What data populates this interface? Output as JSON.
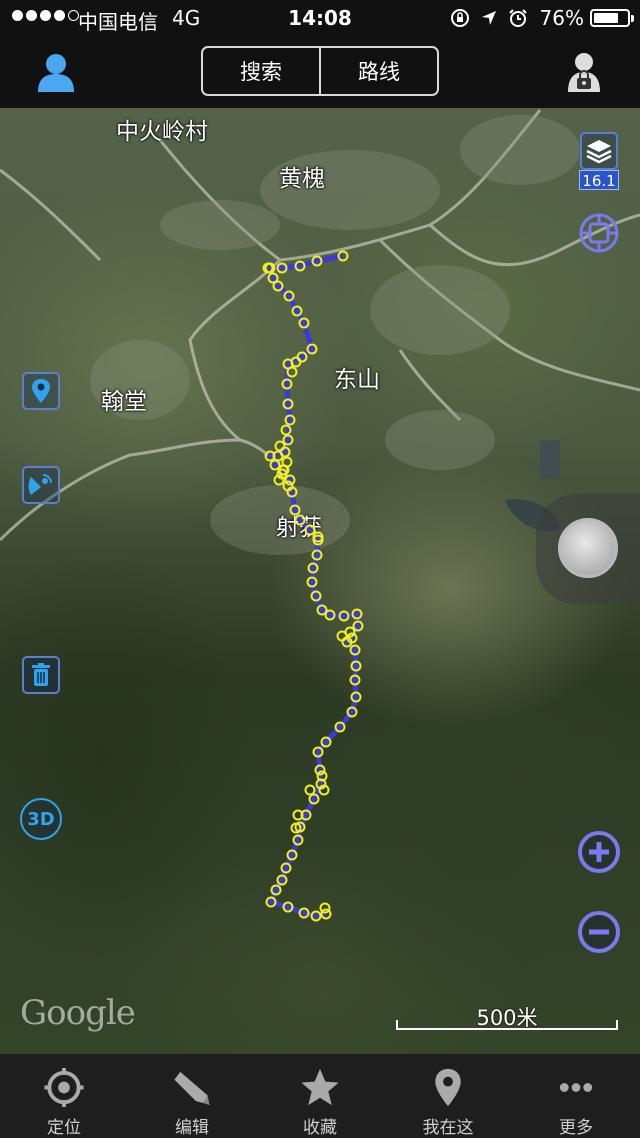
{
  "status_bar": {
    "carrier": "中国电信",
    "network": "4G",
    "time": "14:08",
    "battery": "76%",
    "battery_level": 0.76
  },
  "nav": {
    "search_label": "搜索",
    "route_label": "路线",
    "left_icon": "user-icon",
    "right_icon": "account-lock-icon"
  },
  "map": {
    "labels": [
      "中火岭村",
      "黄槐",
      "东山",
      "翰堂",
      "射获"
    ],
    "layer_zoom": "16.1",
    "watermark": "Google",
    "scale": "500米"
  },
  "controls": {
    "left": [
      "location-pin-icon",
      "satellite-icon",
      "trash-icon",
      "3d-icon"
    ],
    "right": [
      "layers-icon",
      "crosshair-icon",
      "zoom-in-icon",
      "zoom-out-icon"
    ],
    "three_d_label": "3D"
  },
  "tabs": [
    {
      "label": "定位",
      "icon": "locate-icon"
    },
    {
      "label": "编辑",
      "icon": "edit-icon"
    },
    {
      "label": "收藏",
      "icon": "star-icon"
    },
    {
      "label": "我在这",
      "icon": "pin-icon"
    },
    {
      "label": "更多",
      "icon": "more-icon"
    }
  ],
  "colors": {
    "track_line": "#3a3ad6",
    "track_points": "#f2f21a",
    "control_accent": "#7a7af0"
  }
}
